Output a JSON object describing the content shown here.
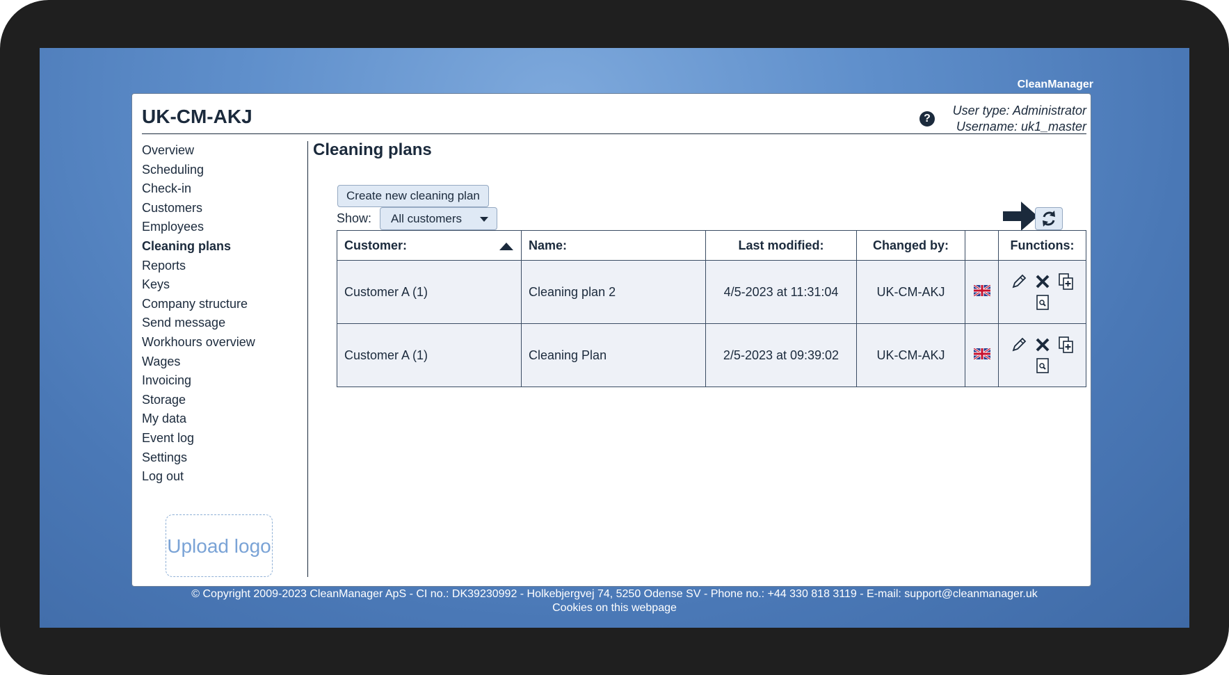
{
  "app_brand": "CleanManager",
  "header": {
    "title": "UK-CM-AKJ",
    "user_type": "User type: Administrator",
    "username": "Username: uk1_master"
  },
  "nav": {
    "items": [
      "Overview",
      "Scheduling",
      "Check-in",
      "Customers",
      "Employees",
      "Cleaning plans",
      "Reports",
      "Keys",
      "Company structure",
      "Send message",
      "Workhours overview",
      "Wages",
      "Invoicing",
      "Storage",
      "My data",
      "Event log",
      "Settings",
      "Log out"
    ],
    "active": "Cleaning plans"
  },
  "upload_logo": "Upload logo",
  "main": {
    "title": "Cleaning plans",
    "create_button": "Create new cleaning plan",
    "show_label": "Show:",
    "show_value": "All customers",
    "table": {
      "headers": [
        "Customer:",
        "Name:",
        "Last modified:",
        "Changed by:",
        "",
        "Functions:"
      ],
      "rows": [
        {
          "customer": "Customer A (1)",
          "name": "Cleaning plan 2",
          "modified": "4/5-2023 at 11:31:04",
          "changed_by": "UK-CM-AKJ"
        },
        {
          "customer": "Customer A (1)",
          "name": "Cleaning Plan",
          "modified": "2/5-2023 at 09:39:02",
          "changed_by": "UK-CM-AKJ"
        }
      ]
    }
  },
  "footer": {
    "line1": "© Copyright 2009-2023 CleanManager ApS - CI no.: DK39230992 - Holkebjergvej 74, 5250 Odense SV - Phone no.: +44 330 818 3119 - E-mail: support@cleanmanager.uk",
    "line2": "Cookies on this webpage"
  },
  "colors": {
    "accent": "#1b2a3c",
    "button_bg": "#dfe9f5",
    "row_bg": "#eef1f7"
  },
  "icons": [
    "help-icon",
    "refresh-icon",
    "arrow-right-icon",
    "edit-icon",
    "delete-icon",
    "copy-icon",
    "preview-icon",
    "uk-flag-icon",
    "sort-up-icon"
  ]
}
